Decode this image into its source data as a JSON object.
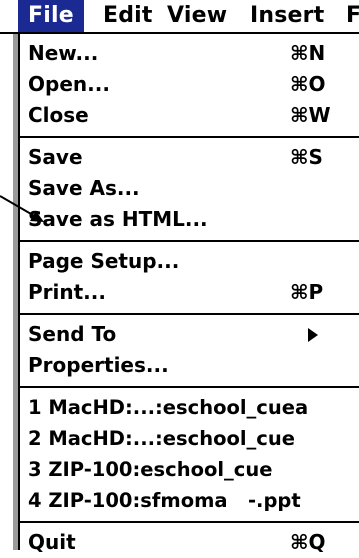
{
  "menubar": {
    "items": [
      "File",
      "Edit",
      "View",
      "Insert",
      "F"
    ]
  },
  "menu": {
    "group1": [
      {
        "label": "New...",
        "shortcut": "⌘N"
      },
      {
        "label": "Open...",
        "shortcut": "⌘O"
      },
      {
        "label": "Close",
        "shortcut": "⌘W"
      }
    ],
    "group2": [
      {
        "label": "Save",
        "shortcut": "⌘S"
      },
      {
        "label": "Save As...",
        "shortcut": ""
      },
      {
        "label": "Save as HTML...",
        "shortcut": ""
      }
    ],
    "group3": [
      {
        "label": "Page Setup...",
        "shortcut": ""
      },
      {
        "label": "Print...",
        "shortcut": "⌘P"
      }
    ],
    "group4": [
      {
        "label": "Send To",
        "shortcut": ""
      },
      {
        "label": "Properties...",
        "shortcut": ""
      }
    ],
    "group5": [
      {
        "label": "1 MacHD:...:eschool_cuea",
        "shortcut": ""
      },
      {
        "label": "2 MacHD:...:eschool_cue",
        "shortcut": ""
      },
      {
        "label": "3 ZIP-100:eschool_cue",
        "shortcut": ""
      },
      {
        "label": "4 ZIP-100:sfmoma   -.ppt",
        "shortcut": ""
      }
    ],
    "group6": [
      {
        "label": "Quit",
        "shortcut": "⌘Q"
      }
    ]
  }
}
